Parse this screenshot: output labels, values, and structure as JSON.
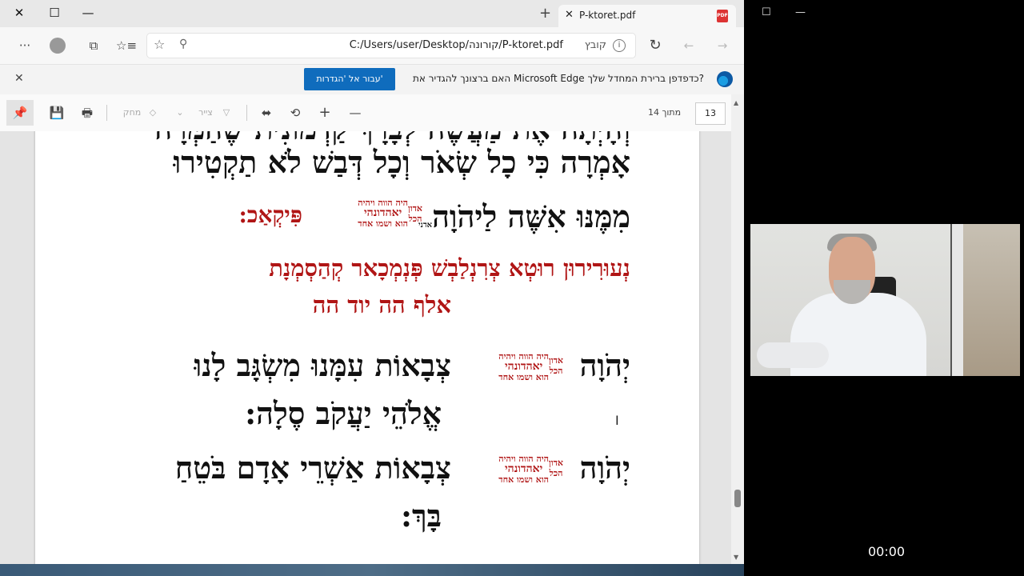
{
  "tab": {
    "title": "P-ktoret.pdf",
    "new_tab": "+",
    "close": "✕"
  },
  "window": {
    "close": "✕",
    "maximize": "☐",
    "minimize": "—"
  },
  "toolbar": {
    "more": "···",
    "favorite_star": "☆",
    "address": "C:/Users/user/Desktop/קורונה/P-ktoret.pdf",
    "scheme_label": "קובץ",
    "info": "i",
    "refresh": "↻",
    "back": "←",
    "forward": "→"
  },
  "infobar": {
    "message": "האם ברצונך להגדיר את Microsoft Edge כדפדפן ברירת המחדל שלך?",
    "button": "עבור אל 'הגדרות'",
    "close": "✕"
  },
  "pdf_toolbar": {
    "page_number": "13",
    "page_total": "מתוך 14",
    "draw": "צייר",
    "erase": "מחק",
    "plus": "+",
    "minus": "—"
  },
  "document": {
    "line0": "וְהָיְתָה אֶת מַעֲשֶׂה לְבָרָךְ קַדְמוֹנִית שֶׁהַמְּרָה",
    "line1": "אָמְרָה כִּי כָל שְׂאֹר וְכָל דְּבַשׁ לֹא תַקְטִירוּ",
    "line2_main": "מִמֶּנּוּ אִשֶּׁה לַיהֹוָה",
    "line2_small": "אדני",
    "line2_end": "פִּיקְאַכ:",
    "names_top": "היה הווה ויהיה",
    "names_mid": "יאהדונהי",
    "names_bot": "הוא ושמו אחד",
    "names_left_top": "אדון",
    "names_left_bot": "הכל",
    "red1": "נְעוּרִירוּן רוּטְא צְרִנְלַבְשׁ פְּנְמְכָאר קְהַסְמְנָת",
    "red2": "אלף הה יוד הה",
    "v1a": "יְהֹוָה",
    "v1b": "צְבָאוֹת עִמָּנוּ מִשְׂגָּב לָנוּ",
    "v1c": "אֱלֹהֵי יַעֲקֹב סֶלָה:",
    "v2b": "צְבָאוֹת אַשְׁרֵי אָדָם בֹּטֵחַ",
    "v2c": "בָּךְ:"
  },
  "video": {
    "timecode": "00:00"
  },
  "overlay_window": {
    "restore": "☐",
    "minimize": "—"
  }
}
